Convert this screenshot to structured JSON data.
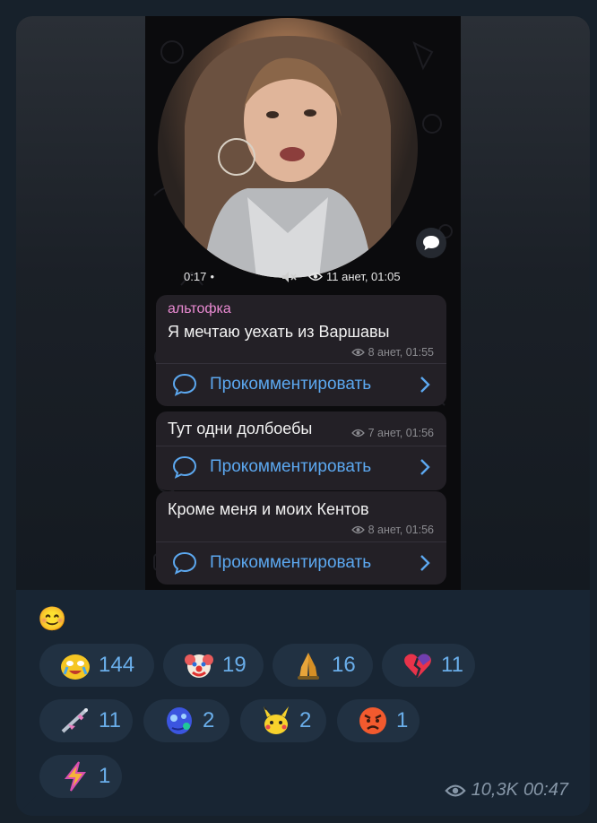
{
  "video": {
    "duration": "0:17",
    "views_time": "11 анет, 01:05"
  },
  "messages": [
    {
      "author": "альтофка",
      "text": "Я мечтаю уехать из Варшавы",
      "meta": "8 анет, 01:55",
      "comment_label": "Прокомментировать"
    },
    {
      "author": "",
      "text": "Тут одни долбоебы",
      "meta": "7 анет, 01:56",
      "comment_label": "Прокомментировать"
    },
    {
      "author": "",
      "text": "Кроме меня и моих Кентов",
      "meta": "8 анет, 01:56",
      "comment_label": "Прокомментировать"
    }
  ],
  "caption_emoji": "😊",
  "reactions": [
    {
      "icon": "cry-laugh-duck-icon",
      "count": "144"
    },
    {
      "icon": "clown-icon",
      "count": "19"
    },
    {
      "icon": "praying-hands-icon",
      "count": "16"
    },
    {
      "icon": "broken-heart-icon",
      "count": "11"
    },
    {
      "icon": "rifle-icon",
      "count": "11"
    },
    {
      "icon": "blue-monster-icon",
      "count": "2"
    },
    {
      "icon": "pikachu-icon",
      "count": "2"
    },
    {
      "icon": "angry-face-icon",
      "count": "1"
    },
    {
      "icon": "lightning-icon",
      "count": "1"
    }
  ],
  "footer": {
    "views": "10,3K",
    "time": "00:47"
  },
  "colors": {
    "accent": "#6aaeea",
    "author": "#e98ad2",
    "bubble": "#182533",
    "reaction_bg": "#213142"
  }
}
